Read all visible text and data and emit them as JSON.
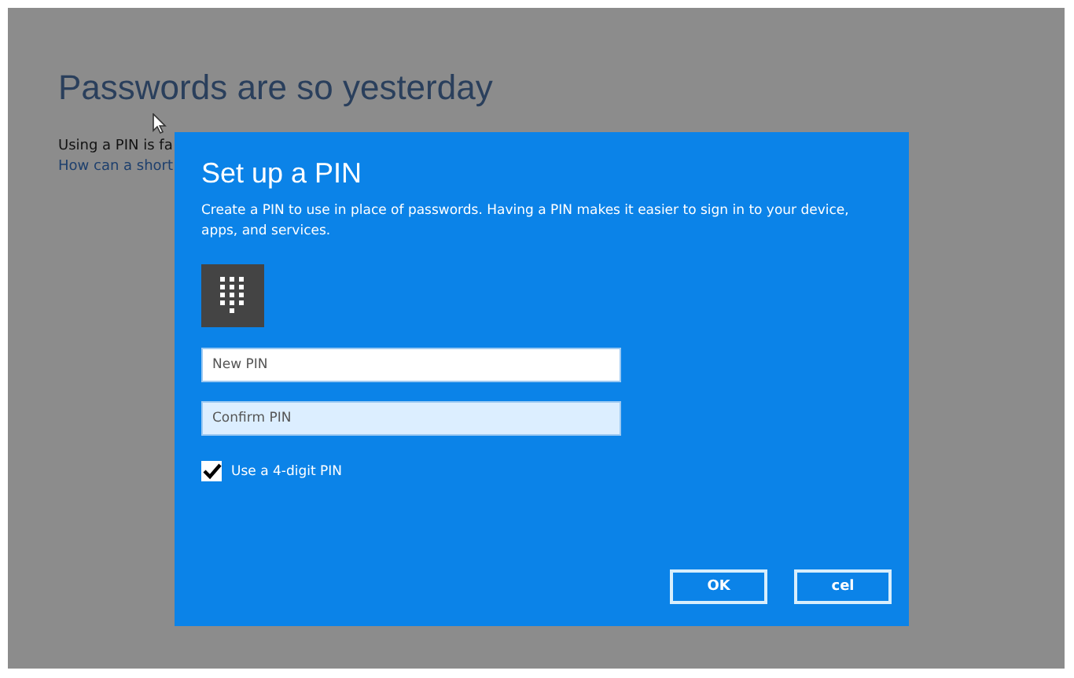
{
  "page": {
    "title": "Passwords are so yesterday",
    "text": "Using a PIN is fa",
    "link": "How can a short"
  },
  "dialog": {
    "title": "Set up a PIN",
    "description": "Create a PIN to use in place of passwords. Having a PIN makes it easier to sign in to your device, apps, and services.",
    "fields": [
      {
        "placeholder": "New PIN",
        "focused": false
      },
      {
        "placeholder": "Confirm PIN",
        "focused": true
      }
    ],
    "checkbox": {
      "label": "Use a 4-digit PIN",
      "checked": true
    },
    "buttons": [
      "OK",
      "cel"
    ]
  }
}
